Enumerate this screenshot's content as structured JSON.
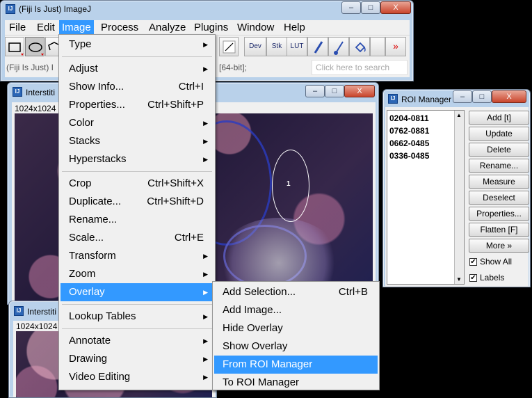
{
  "main_window": {
    "title": "(Fiji Is Just) ImageJ",
    "icon_text": "IJ",
    "controls": [
      "–",
      "□",
      "X"
    ],
    "menus": [
      "File",
      "Edit",
      "Image",
      "Process",
      "Analyze",
      "Plugins",
      "Window",
      "Help"
    ],
    "toolbar_labels": {
      "dev": "Dev",
      "stk": "Stk",
      "lut": "LUT",
      "more": "»"
    },
    "status_left": "(Fiji Is Just) I",
    "status_right": "[64-bit];",
    "search_placeholder": "Click here to search"
  },
  "image_window_1": {
    "title": "Interstiti",
    "dims": "1024x1024",
    "roi_label": "1",
    "controls": [
      "–",
      "□",
      "X"
    ]
  },
  "image_window_2": {
    "title": "Interstiti",
    "dims": "1024x1024"
  },
  "roi_manager": {
    "title": "ROI Manager",
    "items": [
      "0204-0811",
      "0762-0881",
      "0662-0485",
      "0336-0485"
    ],
    "buttons": [
      "Add [t]",
      "Update",
      "Delete",
      "Rename...",
      "Measure",
      "Deselect",
      "Properties...",
      "Flatten [F]",
      "More »"
    ],
    "checks": [
      {
        "label": "Show All",
        "checked": true
      },
      {
        "label": "Labels",
        "checked": true
      }
    ],
    "controls": [
      "–",
      "□",
      "X"
    ]
  },
  "image_menu": {
    "items": [
      {
        "label": "Type",
        "shortcut": "",
        "sub": true
      },
      {
        "label": "Adjust",
        "shortcut": "",
        "sub": true
      },
      {
        "label": "Show Info...",
        "shortcut": "Ctrl+I",
        "sub": false
      },
      {
        "label": "Properties...",
        "shortcut": "Ctrl+Shift+P",
        "sub": false
      },
      {
        "label": "Color",
        "shortcut": "",
        "sub": true
      },
      {
        "label": "Stacks",
        "shortcut": "",
        "sub": true
      },
      {
        "label": "Hyperstacks",
        "shortcut": "",
        "sub": true
      },
      {
        "label": "Crop",
        "shortcut": "Ctrl+Shift+X",
        "sub": false
      },
      {
        "label": "Duplicate...",
        "shortcut": "Ctrl+Shift+D",
        "sub": false
      },
      {
        "label": "Rename...",
        "shortcut": "",
        "sub": false
      },
      {
        "label": "Scale...",
        "shortcut": "Ctrl+E",
        "sub": false
      },
      {
        "label": "Transform",
        "shortcut": "",
        "sub": true
      },
      {
        "label": "Zoom",
        "shortcut": "",
        "sub": true
      },
      {
        "label": "Overlay",
        "shortcut": "",
        "sub": true
      },
      {
        "label": "Lookup Tables",
        "shortcut": "",
        "sub": true
      },
      {
        "label": "Annotate",
        "shortcut": "",
        "sub": true
      },
      {
        "label": "Drawing",
        "shortcut": "",
        "sub": true
      },
      {
        "label": "Video Editing",
        "shortcut": "",
        "sub": true
      }
    ]
  },
  "overlay_submenu": {
    "items": [
      {
        "label": "Add Selection...",
        "shortcut": "Ctrl+B"
      },
      {
        "label": "Add Image...",
        "shortcut": ""
      },
      {
        "label": "Hide Overlay",
        "shortcut": ""
      },
      {
        "label": "Show Overlay",
        "shortcut": ""
      },
      {
        "label": "From ROI Manager",
        "shortcut": ""
      },
      {
        "label": "To ROI Manager",
        "shortcut": ""
      }
    ]
  },
  "colors": {
    "highlight": "#3399ff",
    "frame": "#b9d1ea",
    "roi_outline": "#ffffff",
    "desktop": "#000000"
  }
}
